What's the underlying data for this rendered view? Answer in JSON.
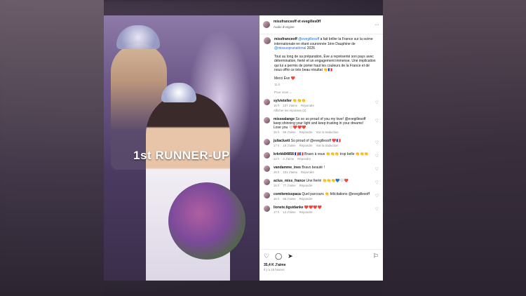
{
  "post": {
    "author": "missfranceoff",
    "coauthor_text": "et evegilles0ff",
    "audio": "Audio d'origine",
    "photo_overlay": "1st RUNNER-UP",
    "caption_user": "missfranceoff",
    "caption_mention": "@evegillesoff",
    "caption_text": "a fait briller la France sur la scène internationale en étant couronnée 1ère Dauphine de",
    "caption_mention2": "@missuspranational",
    "caption_year": "2026",
    "caption_p2": "Tout au long de sa préparation, Ève a représenté son pays avec détermination, fierté et un engagement immense. Une implication qui lui a permis de porter haut les couleurs de la France et de nous offrir ce très beau résultat 👏🇫🇷",
    "caption_p3": "Merci Ève ❤️",
    "caption_time": "11 h",
    "see_more": "Pour vous ⌄"
  },
  "comments": [
    {
      "user": "sylvieteller",
      "text": "👏👏👏",
      "time": "16 h",
      "likes": "107 J'aime",
      "reply": "Répondre",
      "extra": "Afficher les réponses (2)"
    },
    {
      "user": "missealange",
      "text": "So so so proud of you my love! @evegillesoff keep shinning your light and keep trusting in your dreams! Love you 🤍❤️❤️❤️",
      "time": "15 h",
      "likes": "56 J'aime",
      "reply": "Répondre",
      "extra": "Voir la traduction"
    },
    {
      "user": "juliacluett",
      "text": "So proud of @evegillesoff ❤️🇫🇷",
      "time": "17 h",
      "likes": "18 J'aime",
      "reply": "Répondre",
      "extra": "Voir la traduction"
    },
    {
      "user": "krkrkk84858",
      "text": "🇫🇷🇫🇷 Bravo à vous 👏👏👏 trop belle 👏👏👏",
      "time": "12 h",
      "likes": "3 J'aime",
      "reply": "Répondre",
      "extra": ""
    },
    {
      "user": "vandamme_ines",
      "text": "Bravo beauté !",
      "time": "15 h",
      "likes": "101 J'aime",
      "reply": "Répondre",
      "extra": ""
    },
    {
      "user": "actus_miss_france",
      "text": "Une fierté 👏👏👏💙🤍❤️",
      "time": "15 h",
      "likes": "77 J'aime",
      "reply": "Répondre",
      "extra": ""
    },
    {
      "user": "comitemisspaca",
      "text": "Quel parcours 👏 félicitations @evegillesoff",
      "time": "15 h",
      "likes": "66 J'aime",
      "reply": "Répondre",
      "extra": ""
    },
    {
      "user": "lionete.tiguidanke",
      "text": "❤️❤️❤️❤️",
      "time": "17 h",
      "likes": "12 J'aime",
      "reply": "Répondre",
      "extra": ""
    }
  ],
  "footer": {
    "likes": "35,4 K J'aime",
    "ago": "Il y a 19 heures",
    "icons": [
      "heart-icon",
      "comment-icon",
      "share-icon",
      "bookmark-icon"
    ]
  },
  "colors": {
    "link": "#1a6ed8",
    "verified": "#3797f0"
  }
}
